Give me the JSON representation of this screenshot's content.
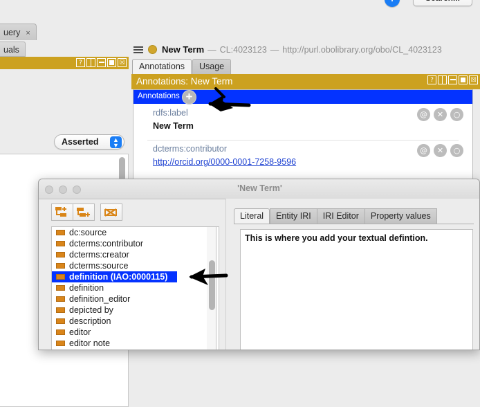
{
  "toolbar": {
    "add_button_label": "+",
    "search_button_label": "Search..."
  },
  "background_tabs": [
    {
      "label": "uery",
      "close": "×"
    }
  ],
  "background_subtabs": [
    {
      "label": "uals"
    }
  ],
  "left_panel": {
    "window_buttons": [
      "?",
      "split",
      "minimize",
      "maximize",
      "close"
    ],
    "close_glyph": "☒",
    "help_glyph": "?",
    "view_selector_value": "Asserted"
  },
  "entity_header": {
    "menu_icon": "hamburger-icon",
    "entity_name": "New Term",
    "separator_1": "—",
    "curie": "CL:4023123",
    "separator_2": "—",
    "iri": "http://purl.obolibrary.org/obo/CL_4023123"
  },
  "entity_tabs": [
    {
      "label": "Annotations",
      "active": true
    },
    {
      "label": "Usage",
      "active": false
    }
  ],
  "annotations_section": {
    "title": "Annotations: New Term",
    "window_buttons": [
      "?",
      "split",
      "minimize",
      "maximize",
      "close"
    ],
    "toolbar_label": "Annotations",
    "add_glyph": "+",
    "rows": [
      {
        "property": "rdfs:label",
        "value": "New Term",
        "is_link": false,
        "icons": [
          "@",
          "✕",
          "○"
        ]
      },
      {
        "property": "dcterms:contributor",
        "value": "http://orcid.org/0000-0001-7258-9596",
        "is_link": true,
        "icons": [
          "@",
          "✕",
          "○"
        ]
      }
    ]
  },
  "dialog": {
    "title": "'New Term'",
    "traffic_lights": [
      "close",
      "minimize",
      "zoom"
    ],
    "toolbar_buttons": [
      "add-sub-property-icon",
      "add-sibling-property-icon",
      "delete-property-icon"
    ],
    "property_list": [
      {
        "label": "dc:source",
        "selected": false
      },
      {
        "label": "dcterms:contributor",
        "selected": false
      },
      {
        "label": "dcterms:creator",
        "selected": false
      },
      {
        "label": "dcterms:source",
        "selected": false
      },
      {
        "label": "definition (IAO:0000115)",
        "selected": true
      },
      {
        "label": "definition",
        "selected": false
      },
      {
        "label": "definition_editor",
        "selected": false
      },
      {
        "label": "depicted by",
        "selected": false
      },
      {
        "label": "description",
        "selected": false
      },
      {
        "label": "editor",
        "selected": false
      },
      {
        "label": "editor note",
        "selected": false
      }
    ],
    "value_tabs": [
      {
        "label": "Literal",
        "active": true
      },
      {
        "label": "Entity IRI",
        "active": false
      },
      {
        "label": "IRI Editor",
        "active": false
      },
      {
        "label": "Property values",
        "active": false
      }
    ],
    "literal_text": "This is where you add your textual defintion."
  },
  "colors": {
    "gold_header": "#cca120",
    "selection_blue": "#0433ff",
    "link_blue": "#1b3fd1",
    "accent_blue": "#1a7df5",
    "property_orange": "#d9851a"
  }
}
